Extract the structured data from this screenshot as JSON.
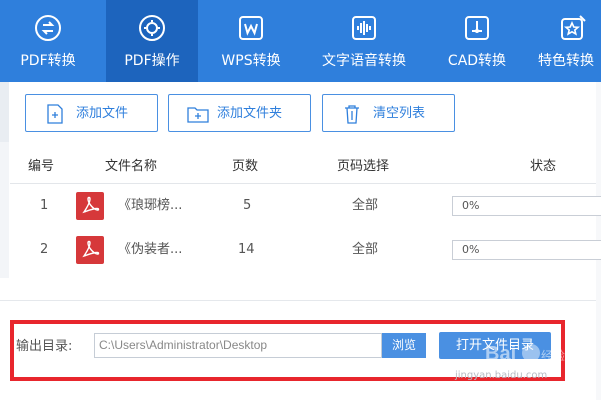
{
  "nav": {
    "items": [
      {
        "label": "PDF转换",
        "icon": "pdf-convert-icon"
      },
      {
        "label": "PDF操作",
        "icon": "pdf-operation-icon"
      },
      {
        "label": "WPS转换",
        "icon": "wps-icon"
      },
      {
        "label": "文字语音转换",
        "icon": "voice-wave-icon"
      },
      {
        "label": "CAD转换",
        "icon": "cad-icon"
      },
      {
        "label": "特色转换",
        "icon": "star-doc-icon"
      }
    ],
    "active_index": 1
  },
  "toolbar": {
    "add_file": "添加文件",
    "add_folder": "添加文件夹",
    "clear_list": "清空列表"
  },
  "table": {
    "headers": {
      "index": "编号",
      "name": "文件名称",
      "pages": "页数",
      "page_select": "页码选择",
      "status": "状态"
    },
    "rows": [
      {
        "index": "1",
        "name": "《琅琊榜...",
        "pages": "5",
        "page_select": "全部",
        "progress": "0%"
      },
      {
        "index": "2",
        "name": "《伪装者...",
        "pages": "14",
        "page_select": "全部",
        "progress": "0%"
      }
    ]
  },
  "output": {
    "label": "输出目录:",
    "path": "C:\\Users\\Administrator\\Desktop",
    "browse": "浏览",
    "open_folder": "打开文件目录"
  },
  "watermark": {
    "text": "jingyan.baidu.com"
  },
  "colors": {
    "nav_bg": "#2f7fdc",
    "nav_active": "#1d64bd",
    "accent": "#4a90e2",
    "highlight_box": "#e8262d",
    "pdf_icon": "#d6383a"
  }
}
